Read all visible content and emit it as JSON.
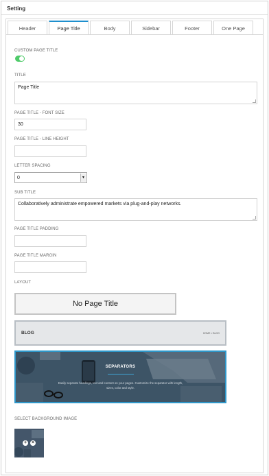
{
  "panel": {
    "title": "Setting"
  },
  "tabs": [
    {
      "label": "Header",
      "active": false
    },
    {
      "label": "Page Title",
      "active": true
    },
    {
      "label": "Body",
      "active": false
    },
    {
      "label": "Sidebar",
      "active": false
    },
    {
      "label": "Footer",
      "active": false
    },
    {
      "label": "One Page",
      "active": false
    }
  ],
  "custom_page_title": {
    "label": "CUSTOM PAGE TITLE",
    "enabled": true
  },
  "title": {
    "label": "TITLE",
    "value": "Page Title"
  },
  "font_size": {
    "label": "PAGE TITLE - FONT SIZE",
    "value": "30"
  },
  "line_height": {
    "label": "PAGE TITLE - LINE HEIGHT",
    "value": ""
  },
  "letter_spacing": {
    "label": "LETTER SPACING",
    "selected": "0"
  },
  "sub_title": {
    "label": "SUB TITLE",
    "value": "Collaboratively administrate empowered markets via plug-and-play networks."
  },
  "padding": {
    "label": "PAGE TITLE PADDING",
    "value": ""
  },
  "margin": {
    "label": "PAGE TITLE MARGIN",
    "value": ""
  },
  "layout": {
    "label": "LAYOUT",
    "option_none": "No Page Title",
    "option_blog": {
      "title": "BLOG",
      "breadcrumb": "HOME > BLOG"
    },
    "option_separators": {
      "title": "SEPARATORS",
      "desc": "Easily separate headings, text and content on your pages. Customize the separator with length, sizes, color and style."
    }
  },
  "background": {
    "label": "SELECT BACKGROUND IMAGE"
  },
  "colors": {
    "accent": "#1e8fcd",
    "toggle_on": "#4fcb6a"
  }
}
